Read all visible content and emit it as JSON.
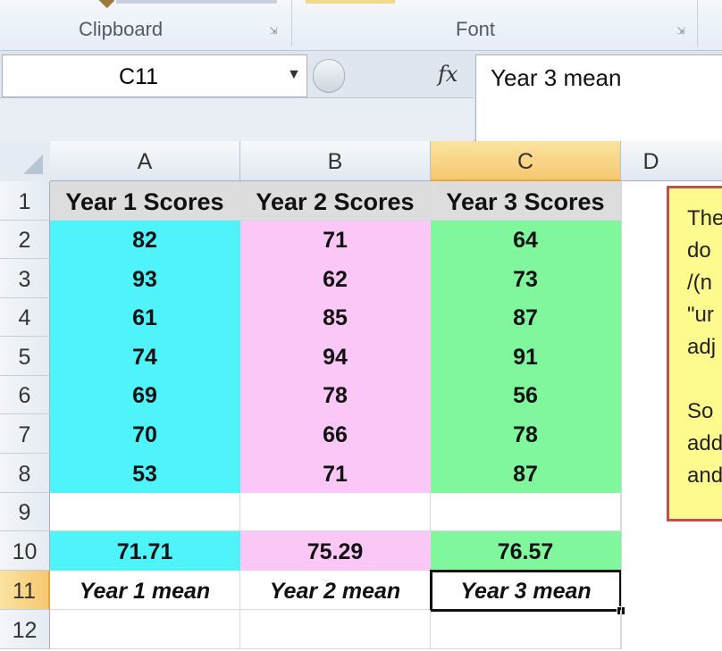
{
  "ribbon": {
    "groups": [
      {
        "label": "Clipboard"
      },
      {
        "label": "Font"
      }
    ]
  },
  "formula_bar": {
    "name_box": "C11",
    "fx": "fx",
    "content": "Year 3 mean"
  },
  "columns": [
    "A",
    "B",
    "C",
    "D"
  ],
  "selected_column": "C",
  "rows": [
    "1",
    "2",
    "3",
    "4",
    "5",
    "6",
    "7",
    "8",
    "9",
    "10",
    "11",
    "12"
  ],
  "selected_row": "11",
  "headers": [
    "Year 1 Scores",
    "Year 2 Scores",
    "Year 3 Scores"
  ],
  "scores": {
    "year1": [
      "82",
      "93",
      "61",
      "74",
      "69",
      "70",
      "53"
    ],
    "year2": [
      "71",
      "62",
      "85",
      "94",
      "78",
      "66",
      "71"
    ],
    "year3": [
      "64",
      "73",
      "87",
      "91",
      "56",
      "78",
      "87"
    ]
  },
  "means": [
    "71.71",
    "75.29",
    "76.57"
  ],
  "mean_labels": [
    "Year 1 mean",
    "Year 2 mean",
    "Year 3 mean"
  ],
  "comment_lines": [
    "The",
    "do",
    "/(n",
    "\"ur",
    "adj",
    "",
    "So",
    "add",
    "and"
  ],
  "colors": {
    "year1": "#4ff4fb",
    "year2": "#fbc7f7",
    "year3": "#80f79c",
    "comment_bg": "#fdfb8e",
    "comment_border": "#c0504d",
    "selection_header": "#f5c871"
  }
}
